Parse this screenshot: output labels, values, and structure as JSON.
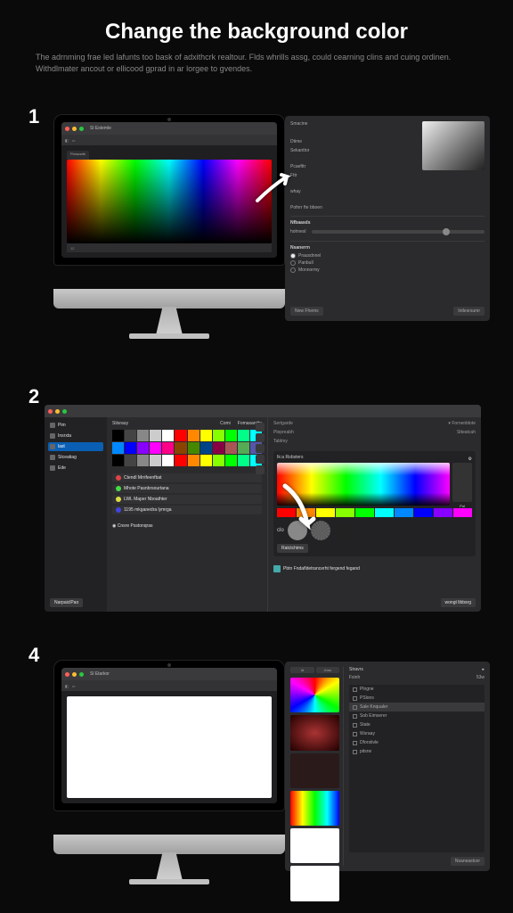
{
  "title": "Change the background color",
  "subtitle": "The adrnming frae led lafunts too bask of adxithcrk realtour. Flds whrills assg, could cearning clins and cuing ordinen. Withdlmater ancout or ellicood gprad in ar lorgee to gvendes.",
  "steps": {
    "one": "1",
    "two": "2",
    "four": "4"
  },
  "step1": {
    "app_title": "Sl Estemle",
    "tab": "Fbnscwib",
    "status": "12"
  },
  "panel1": {
    "tabs": [
      "Smacine"
    ],
    "labels": [
      "Dtime",
      "Sekanttor",
      "Pcaefttr",
      "Fttr",
      "whay",
      "Pofnrr fte bboen"
    ],
    "section1": "Nfbaasds",
    "slider_label": "hohnesl",
    "section2": "Nsanerrn",
    "radios": [
      "Prausdnnel",
      "Panbull",
      "Monnormy"
    ],
    "btn_left": "New Fhems",
    "btn_right": "Intlesrsumr"
  },
  "wide": {
    "sidebar": [
      "Pim",
      "Insrxta",
      "last",
      "Stceatiag",
      "Ede"
    ],
    "sidebar_active_index": 2,
    "swatch_title": "Stisrauy",
    "swatch_tabs": [
      "Comi",
      "Fomasaniite"
    ],
    "list_items": [
      "Ctendl Mrrifeenfbat",
      "Mhote Pasnbrsourtana",
      "LWL Maper Nboathter",
      "1195 mkganedra lymrga"
    ],
    "extra_item": "Cnsre Psstonqras",
    "right_headers": [
      "Sertgarde",
      "Plepreabh",
      "Tablmy"
    ],
    "right_sub": [
      "Fornenblote",
      "Stteatcah"
    ],
    "picker_title": "Ik:a Robsters",
    "picker_toggle": "Fol",
    "clo": "clo",
    "preset_btn": "Ratctchims",
    "bottom_left": "NarpaiclPao",
    "bottom_chip": "Pbtn Fndafldetrancerht fergend fegand",
    "bottom_right": "wongt libbsrg"
  },
  "step4": {
    "app_title": "Sl Etarkor",
    "tabs_left": [
      "Id",
      "Jnos"
    ],
    "swatches": [
      "conic",
      "radial",
      "dark",
      "spectrum",
      "white",
      "white"
    ],
    "right_title": "Stravrs",
    "cols": [
      "Fsinh",
      "53w"
    ],
    "props": [
      "Plngne",
      "PSlons",
      "Sale Knqualer",
      "Sob Eimserer",
      "State",
      "Wsraay",
      "Dforstivle",
      "pitsrw"
    ],
    "btn": "Nsaneastcer"
  },
  "colors": {
    "accent": "#0a5fb4"
  }
}
